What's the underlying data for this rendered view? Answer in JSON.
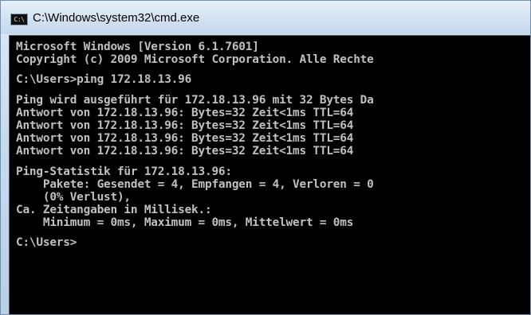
{
  "window": {
    "title": "C:\\Windows\\system32\\cmd.exe",
    "icon_text": "C:\\"
  },
  "console": {
    "lines": [
      "Microsoft Windows [Version 6.1.7601]",
      "Copyright (c) 2009 Microsoft Corporation. Alle Rechte",
      "",
      "C:\\Users>ping 172.18.13.96",
      "",
      "Ping wird ausgeführt für 172.18.13.96 mit 32 Bytes Da",
      "Antwort von 172.18.13.96: Bytes=32 Zeit<1ms TTL=64",
      "Antwort von 172.18.13.96: Bytes=32 Zeit<1ms TTL=64",
      "Antwort von 172.18.13.96: Bytes=32 Zeit<1ms TTL=64",
      "Antwort von 172.18.13.96: Bytes=32 Zeit<1ms TTL=64",
      "",
      "Ping-Statistik für 172.18.13.96:",
      "    Pakete: Gesendet = 4, Empfangen = 4, Verloren = 0",
      "    (0% Verlust),",
      "Ca. Zeitangaben in Millisek.:",
      "    Minimum = 0ms, Maximum = 0ms, Mittelwert = 0ms",
      "",
      "C:\\Users>"
    ]
  },
  "colors": {
    "console_bg": "#000000",
    "console_fg": "#c0c0c0",
    "title_bg": "#d5e3f2"
  }
}
